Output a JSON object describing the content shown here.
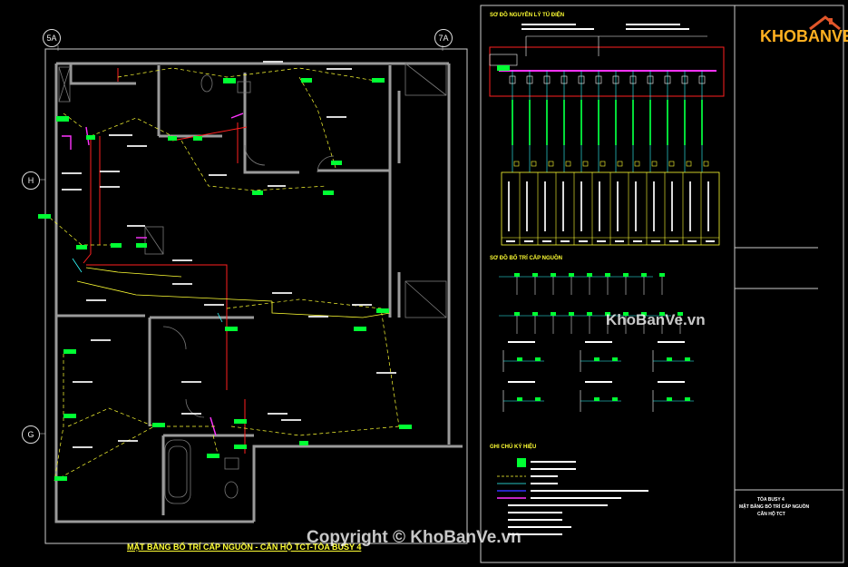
{
  "grid": {
    "bubble_5a": "5A",
    "bubble_7a": "7A",
    "bubble_h": "H",
    "bubble_g": "G"
  },
  "plan": {
    "title": "MẶT BẰNG BỐ TRÍ CẤP NGUỒN - CĂN HỘ TCT-TÒA BUSY 4"
  },
  "schematic": {
    "section1_title": "SƠ ĐỒ NGUYÊN LÝ TỦ ĐIỆN",
    "section2_title": "SƠ ĐỒ BỐ TRÍ CẤP NGUỒN",
    "section3_title": "GHI CHÚ KÝ HIỆU"
  },
  "title_block": {
    "line1": "TÒA BUSY 4",
    "line2": "MẶT BẰNG BỐ TRÍ CẤP NGUỒN",
    "line3": "CĂN HỘ TCT"
  },
  "brand": {
    "logo": "KHOBANVE",
    "watermark_center": "KhoBanVe.vn",
    "watermark_bottom": "Copyright © KhoBanVe.vn"
  },
  "colors": {
    "wall": "#9a9a9a",
    "green": "#00ff33",
    "yellow": "#ffff33",
    "red": "#ff2020",
    "magenta": "#ff33ff",
    "cyan": "#33ffff",
    "border": "#cccccc"
  }
}
